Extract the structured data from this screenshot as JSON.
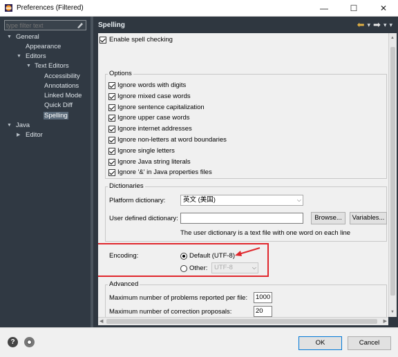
{
  "window": {
    "title": "Preferences (Filtered)",
    "minimize": "—",
    "maximize": "☐",
    "close": "✕"
  },
  "filter": {
    "placeholder": "type filter text",
    "value": ""
  },
  "tree": {
    "general": "General",
    "appearance": "Appearance",
    "editors": "Editors",
    "text_editors": "Text Editors",
    "accessibility": "Accessibility",
    "annotations": "Annotations",
    "linked_mode": "Linked Mode",
    "quick_diff": "Quick Diff",
    "spelling": "Spelling",
    "java": "Java",
    "editor": "Editor"
  },
  "page": {
    "title": "Spelling",
    "enable_spell_checking": "Enable spell checking"
  },
  "options": {
    "title": "Options",
    "items": [
      "Ignore words with digits",
      "Ignore mixed case words",
      "Ignore sentence capitalization",
      "Ignore upper case words",
      "Ignore internet addresses",
      "Ignore non-letters at word boundaries",
      "Ignore single letters",
      "Ignore Java string literals",
      "Ignore '&' in Java properties files"
    ]
  },
  "dictionaries": {
    "title": "Dictionaries",
    "platform_label": "Platform dictionary:",
    "platform_value": "英文 (美国)",
    "user_label": "User defined dictionary:",
    "user_value": "",
    "browse": "Browse...",
    "variables": "Variables...",
    "note": "The user dictionary is a text file with one word on each line"
  },
  "encoding": {
    "label": "Encoding:",
    "default_option": "Default (UTF-8)",
    "other_option": "Other:",
    "other_value": "UTF-8"
  },
  "advanced": {
    "title": "Advanced",
    "max_problems_label": "Maximum number of problems reported per file:",
    "max_problems_value": "1000",
    "max_corrections_label": "Maximum number of correction proposals:",
    "max_corrections_value": "20"
  },
  "footer": {
    "ok": "OK",
    "cancel": "Cancel"
  },
  "colors": {
    "accent": "#0078d7",
    "annotation_red": "#e0262c",
    "sidebar_bg": "#303943"
  }
}
